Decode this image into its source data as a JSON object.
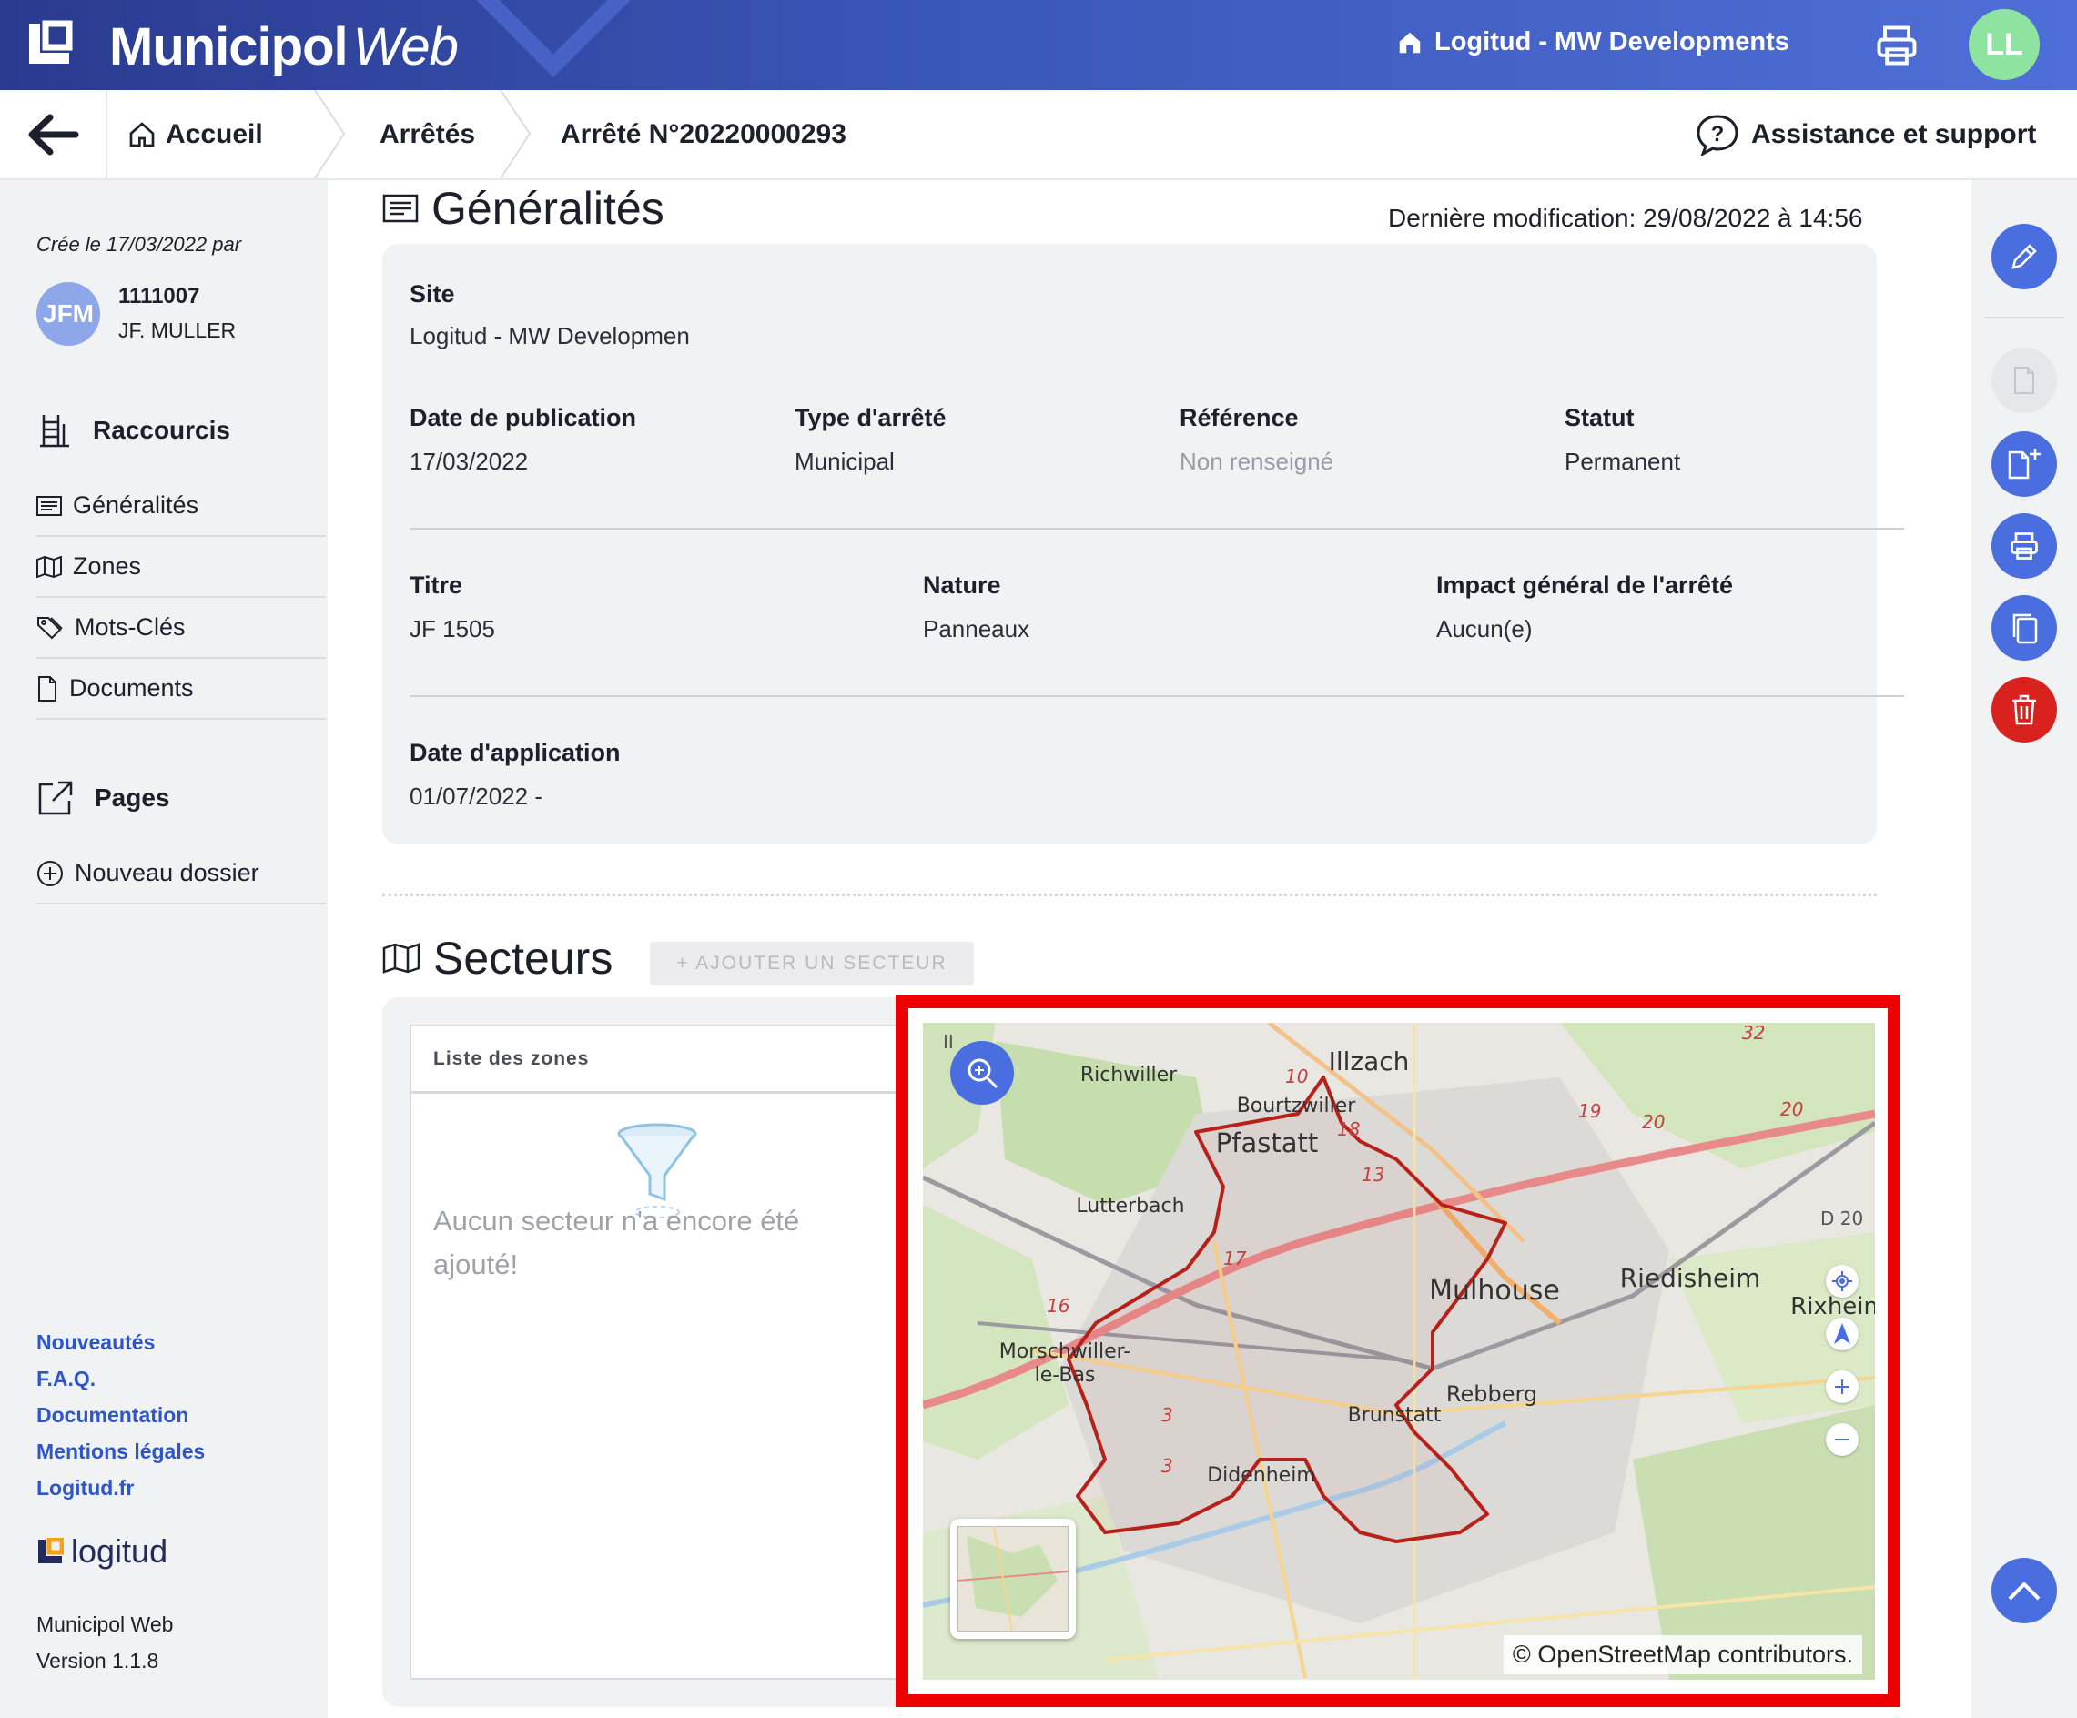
{
  "header": {
    "brand_main": "Municipol",
    "brand_sub": "Web",
    "organization": "Logitud - MW Developments",
    "user_initials": "LL"
  },
  "breadcrumb": {
    "home": "Accueil",
    "level1": "Arrêtés",
    "current": "Arrêté N°20220000293",
    "support": "Assistance et support"
  },
  "sidebar": {
    "created": "Crée le 17/03/2022 par",
    "user_initials": "JFM",
    "user_id": "1111007",
    "user_name": "JF. MULLER",
    "shortcuts_title": "Raccourcis",
    "items": [
      {
        "label": "Généralités",
        "icon": "document-lines-icon"
      },
      {
        "label": "Zones",
        "icon": "map-icon"
      },
      {
        "label": "Mots-Clés",
        "icon": "tag-icon"
      },
      {
        "label": "Documents",
        "icon": "file-icon"
      }
    ],
    "pages_title": "Pages",
    "new_folder": "Nouveau dossier",
    "footer_links": [
      "Nouveautés",
      "F.A.Q.",
      "Documentation",
      "Mentions légales",
      "Logitud.fr"
    ],
    "company": "logitud",
    "app_name": "Municipol Web",
    "app_version": "Version 1.1.8"
  },
  "general": {
    "title": "Généralités",
    "last_modified": "Dernière modification: 29/08/2022 à 14:56",
    "site_label": "Site",
    "site_value": "Logitud - MW Developmen",
    "pub_date_label": "Date de publication",
    "pub_date_value": "17/03/2022",
    "type_label": "Type d'arrêté",
    "type_value": "Municipal",
    "ref_label": "Référence",
    "ref_value": "Non renseigné",
    "status_label": "Statut",
    "status_value": "Permanent",
    "title_label": "Titre",
    "title_value": "JF 1505",
    "nature_label": "Nature",
    "nature_value": "Panneaux",
    "impact_label": "Impact général de l'arrêté",
    "impact_value": "Aucun(e)",
    "app_date_label": "Date d'application",
    "app_date_value": "01/07/2022 -"
  },
  "sectors": {
    "title": "Secteurs",
    "add_button": "+ AJOUTER UN SECTEUR",
    "zones_header": "Liste des zones",
    "empty_message": "Aucun secteur n'a encore été ajouté!"
  },
  "map": {
    "attribution": "© OpenStreetMap contributors.",
    "places": [
      "Illzach",
      "Richwiller",
      "Bourtzwiller",
      "Pfastatt",
      "Lutterbach",
      "Mulhouse",
      "Riedisheim",
      "Rixheim",
      "Morschwiller-le-Bas",
      "Rebberg",
      "Brunstatt",
      "Didenheim"
    ],
    "road_numbers": [
      "10",
      "18",
      "19",
      "20",
      "13",
      "17",
      "16",
      "3",
      "D 20",
      "32",
      "II"
    ],
    "highlight_color": "#ee0000"
  },
  "colors": {
    "accent": "#4a6ee0",
    "danger": "#d9211d",
    "link": "#2f56c9"
  }
}
